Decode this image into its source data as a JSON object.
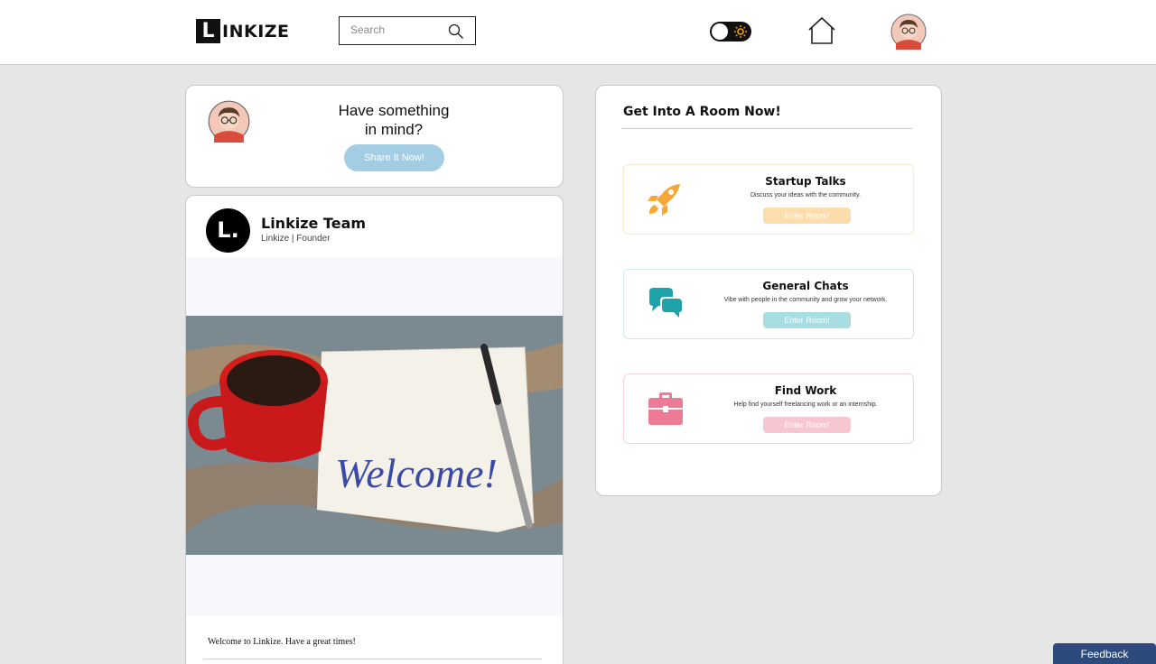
{
  "nav": {
    "logo_letter": "L",
    "logo_text": "INKIZE",
    "search_placeholder": "Search"
  },
  "compose": {
    "title_line1": "Have something",
    "title_line2": "in mind?",
    "share_button": "Share It Now!"
  },
  "post": {
    "avatar_text": "L.",
    "author": "Linkize Team",
    "subtitle": "Linkize | Founder",
    "image_text": "Welcome!",
    "caption": "Welcome to Linkize. Have a great times!"
  },
  "rooms": {
    "title": "Get Into A Room Now!",
    "items": [
      {
        "name": "Startup Talks",
        "description": "Discuss your ideas with the community.",
        "button": "Enter Room!",
        "border": "#fde6c9",
        "button_color": "#fddcae",
        "icon_color": "#f6a735",
        "icon": "rocket-icon"
      },
      {
        "name": "General Chats",
        "description": "Vibe with people in the community and grow your network.",
        "button": "Enter Room!",
        "border": "#cde9ec",
        "button_color": "#a8dde1",
        "icon_color": "#1fa3a9",
        "icon": "chat-bubbles-icon"
      },
      {
        "name": "Find Work",
        "description": "Help find yourself freelancing work or an internship.",
        "button": "Enter Room!",
        "border": "#f8d3dc",
        "button_color": "#f8c6d1",
        "icon_color": "#ee7b96",
        "icon": "briefcase-icon"
      }
    ]
  },
  "feedback_label": "Feedback"
}
